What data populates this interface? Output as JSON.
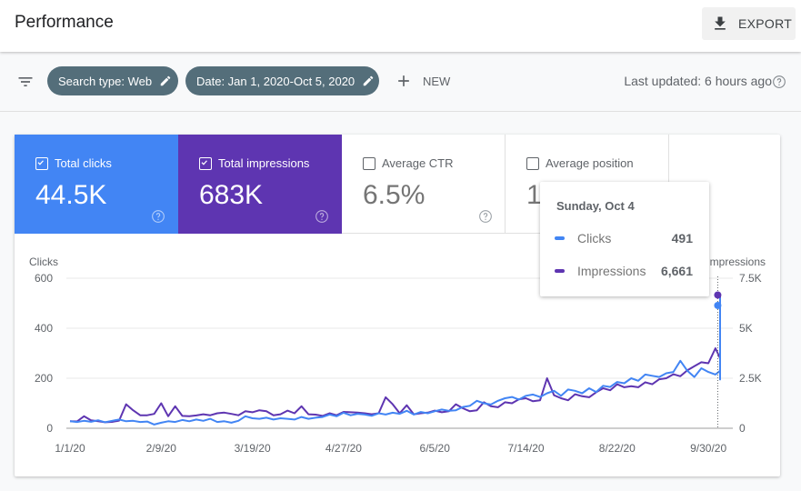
{
  "header": {
    "title": "Performance",
    "export_label": "EXPORT"
  },
  "filters": {
    "chips": [
      {
        "label": "Search type: Web"
      },
      {
        "label": "Date: Jan 1, 2020-Oct 5, 2020"
      }
    ],
    "new_label": "NEW",
    "last_updated": "Last updated: 6 hours ago"
  },
  "metrics": [
    {
      "label": "Total clicks",
      "value": "44.5K",
      "checked": true,
      "color": "#4285f4"
    },
    {
      "label": "Total impressions",
      "value": "683K",
      "checked": true,
      "color": "#5e35b1"
    },
    {
      "label": "Average CTR",
      "value": "6.5%",
      "checked": false
    },
    {
      "label": "Average position",
      "value": "18.8",
      "checked": false
    }
  ],
  "tooltip": {
    "date": "Sunday, Oct 4",
    "rows": [
      {
        "label": "Clicks",
        "value": "491",
        "color": "#4285f4"
      },
      {
        "label": "Impressions",
        "value": "6,661",
        "color": "#5e35b1"
      }
    ]
  },
  "chart_data": {
    "type": "line",
    "title": "",
    "xlabel": "",
    "ylabel": "Clicks",
    "y2label": "Impressions",
    "ylim": [
      0,
      600
    ],
    "y2lim": [
      0,
      7500
    ],
    "yticks": [
      "0",
      "200",
      "400",
      "600"
    ],
    "y2ticks": [
      "0",
      "2.5K",
      "5K",
      "7.5K"
    ],
    "x_start": "2020-01-01",
    "x_step_days": 3,
    "xticks": [
      {
        "label": "1/1/20",
        "day": 0
      },
      {
        "label": "2/9/20",
        "day": 39
      },
      {
        "label": "3/19/20",
        "day": 78
      },
      {
        "label": "4/27/20",
        "day": 117
      },
      {
        "label": "6/5/20",
        "day": 156
      },
      {
        "label": "7/14/20",
        "day": 195
      },
      {
        "label": "8/22/20",
        "day": 234
      },
      {
        "label": "9/30/20",
        "day": 273
      }
    ],
    "grid": true,
    "highlight": {
      "label": "Sunday, Oct 4",
      "day": 277,
      "clicks": 491,
      "impressions": 6661
    },
    "series": [
      {
        "name": "Clicks",
        "axis": "left",
        "color": "#4285f4",
        "values": [
          28,
          25,
          30,
          26,
          32,
          24,
          30,
          35,
          28,
          30,
          25,
          27,
          15,
          22,
          28,
          25,
          33,
          28,
          35,
          30,
          38,
          25,
          28,
          22,
          30,
          48,
          40,
          38,
          42,
          35,
          40,
          38,
          35,
          45,
          38,
          42,
          45,
          55,
          48,
          62,
          52,
          58,
          55,
          50,
          60,
          55,
          62,
          58,
          70,
          55,
          65,
          60,
          68,
          75,
          70,
          72,
          85,
          90,
          110,
          100,
          95,
          110,
          120,
          125,
          115,
          130,
          135,
          125,
          140,
          150,
          130,
          155,
          150,
          140,
          160,
          145,
          170,
          165,
          185,
          180,
          200,
          190,
          215,
          210,
          205,
          220,
          225,
          270,
          230,
          205,
          240,
          225,
          215,
          230,
          210,
          225,
          200,
          235,
          195,
          220,
          210,
          270,
          215,
          240,
          220,
          245,
          235,
          205,
          265,
          225,
          285,
          230,
          245,
          255,
          250,
          230,
          265,
          275,
          260,
          245,
          285,
          250,
          275,
          240,
          255,
          265,
          260,
          290,
          300,
          255,
          270,
          315,
          245,
          295,
          300,
          240,
          320,
          290,
          285,
          290,
          340,
          305,
          265,
          305,
          345,
          285,
          300,
          310,
          350,
          330,
          300,
          380,
          330,
          340,
          370,
          395,
          350,
          410,
          380,
          390,
          340,
          400,
          360,
          380,
          430,
          400,
          415,
          380,
          420,
          360,
          400,
          440,
          380,
          360,
          420,
          375,
          410,
          395,
          380,
          410,
          400,
          430,
          410,
          480,
          520,
          360,
          370,
          390,
          491,
          450
        ]
      },
      {
        "name": "Impressions",
        "axis": "right",
        "color": "#5e35b1",
        "values": [
          350,
          340,
          600,
          400,
          350,
          300,
          320,
          380,
          1200,
          900,
          650,
          650,
          720,
          1250,
          600,
          1100,
          620,
          600,
          640,
          700,
          650,
          750,
          780,
          720,
          650,
          850,
          800,
          900,
          850,
          650,
          700,
          880,
          750,
          1100,
          700,
          680,
          620,
          750,
          650,
          820,
          800,
          780,
          750,
          700,
          750,
          1550,
          1200,
          750,
          1150,
          700,
          750,
          780,
          880,
          800,
          850,
          1200,
          1000,
          850,
          900,
          1300,
          1100,
          1050,
          1300,
          1250,
          1450,
          1500,
          1350,
          1400,
          2500,
          1650,
          1500,
          1400,
          1700,
          1600,
          1550,
          1800,
          2000,
          1900,
          2200,
          2050,
          2100,
          2050,
          2300,
          2200,
          2450,
          2500,
          2700,
          2600,
          2900,
          3100,
          3300,
          3250,
          4000,
          3500,
          3800,
          3700,
          3900,
          3500,
          3300,
          3400,
          3200,
          3100,
          3050,
          2900,
          2850,
          3200,
          3000,
          2800,
          3500,
          3100,
          3200,
          2950,
          3050,
          2700,
          2900,
          3100,
          3300,
          3050,
          3200,
          3000,
          3400,
          3600,
          3100,
          3200,
          3700,
          3250,
          3000,
          3550,
          3250,
          3600,
          3900,
          3400,
          3000,
          3500,
          4000,
          3600,
          3350,
          3700,
          3400,
          3550,
          3800,
          4000,
          3750,
          3350,
          3600,
          4500,
          3700,
          3900,
          4000,
          3800,
          3950,
          3700,
          4300,
          3900,
          4300,
          3700,
          3800,
          4400,
          4800,
          4200,
          4000,
          4400,
          4700,
          4300,
          3850,
          3700,
          4200,
          3900,
          4100,
          4300,
          4200,
          4200,
          4100,
          4300,
          4500,
          5000,
          5300,
          4800,
          5200,
          4500,
          4900,
          5300,
          4800,
          4700,
          5400,
          5600,
          5800,
          6400,
          6200,
          6500,
          6000,
          5600,
          6100,
          6661,
          6200
        ]
      }
    ]
  }
}
